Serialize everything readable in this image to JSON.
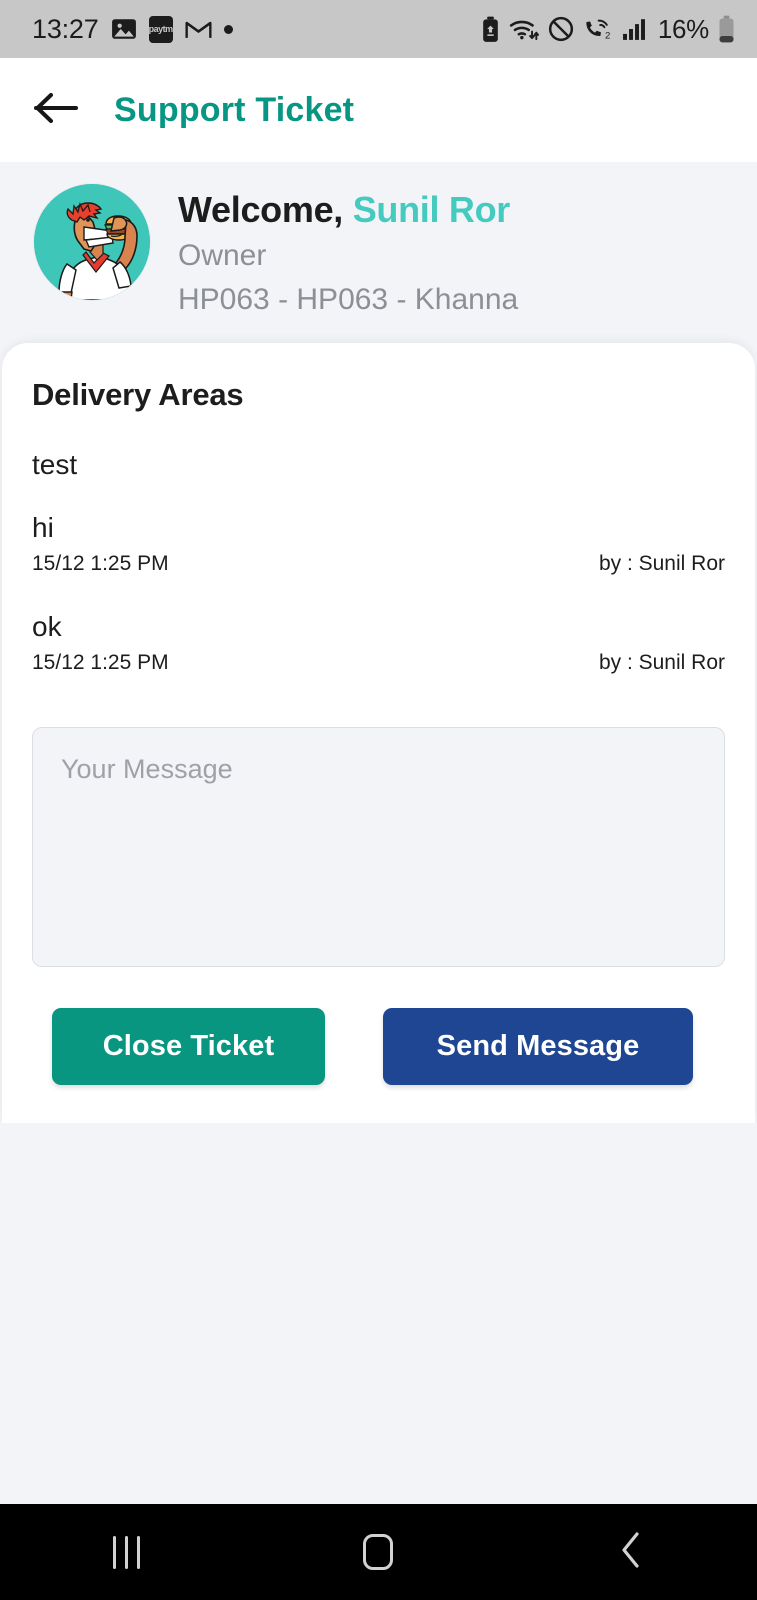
{
  "status_bar": {
    "time": "13:27",
    "battery_percent": "16%",
    "left_icons": [
      "gallery-icon",
      "paytm-icon",
      "gmail-icon",
      "dot-icon"
    ],
    "paytm_label": "paytm",
    "right_icons": [
      "battery-saver-icon",
      "wifi-icon",
      "do-not-disturb-icon",
      "call-forwarding-icon",
      "signal-bars-icon",
      "battery-icon"
    ],
    "background_color": "#c7c7c7"
  },
  "app_bar": {
    "back_icon": "arrow-left-icon",
    "title": "Support Ticket",
    "title_color": "#089684"
  },
  "welcome": {
    "greeting": "Welcome, ",
    "user_name": "Sunil Ror",
    "user_name_color": "#45cabf",
    "role": "Owner",
    "store": "HP063 - HP063 - Khanna",
    "avatar_icon": "user-avatar-burger-icon",
    "avatar_background": "#3ec6b8"
  },
  "ticket": {
    "title": "Delivery Areas",
    "subject": "test",
    "messages": [
      {
        "body": "hi",
        "time": "15/12 1:25 PM",
        "author": "by : Sunil Ror"
      },
      {
        "body": "ok",
        "time": "15/12 1:25 PM",
        "author": "by : Sunil Ror"
      }
    ]
  },
  "composer": {
    "placeholder": "Your Message",
    "value": ""
  },
  "actions": {
    "close_ticket_label": "Close Ticket",
    "close_ticket_color": "#089681",
    "send_message_label": "Send Message",
    "send_message_color": "#1e4693"
  },
  "nav_bar": {
    "recents_icon": "recents-icon",
    "home_icon": "home-icon",
    "back_icon": "chevron-left-icon",
    "background_color": "#000000"
  }
}
